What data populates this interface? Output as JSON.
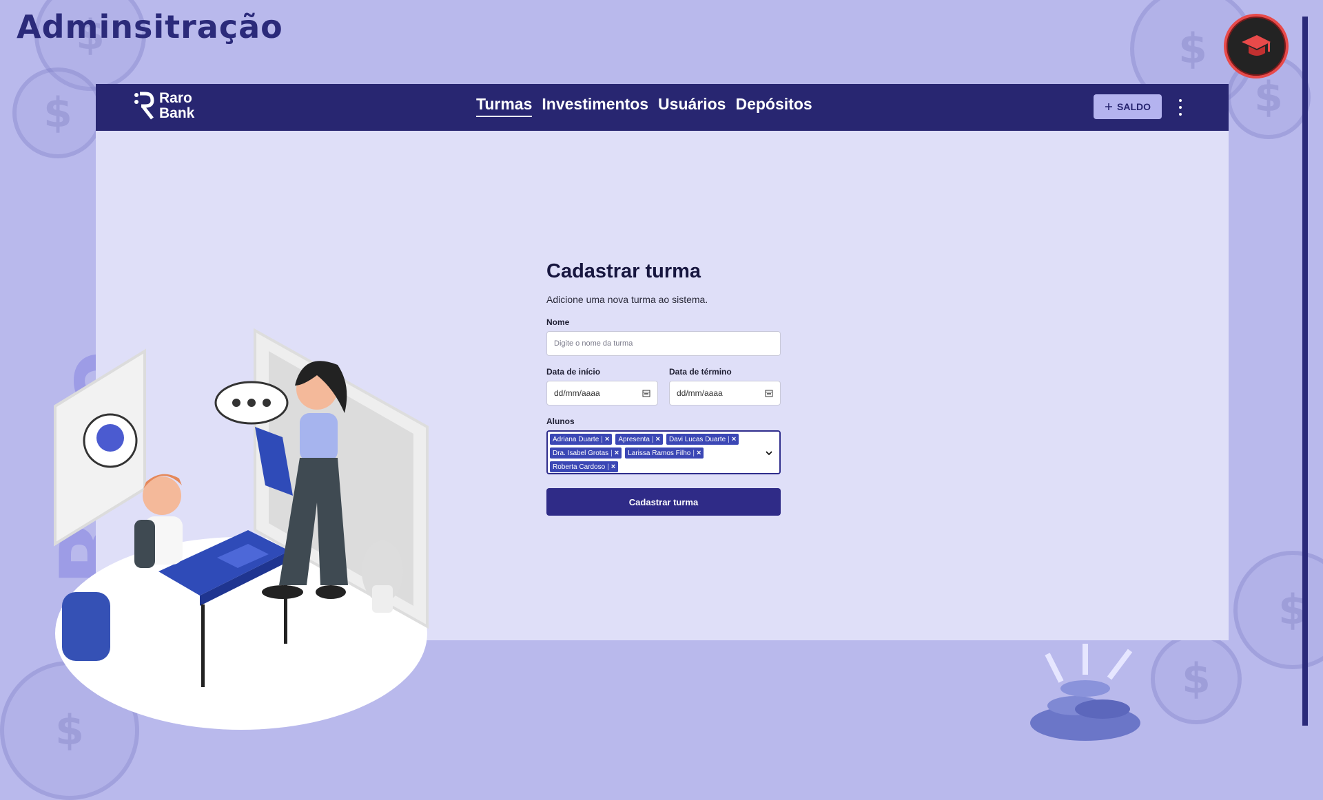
{
  "page_title": "Adminsitração",
  "vertical_brand": "Raro Bank",
  "colors": {
    "background": "#b9b9ec",
    "navbar": "#282671",
    "content": "#dfdff8",
    "primary_button": "#2f2b87",
    "chip": "#3b47b5",
    "saldo_button": "#b4b3ef"
  },
  "navbar": {
    "logo_text": "Raro\nBank",
    "links": [
      {
        "label": "Turmas",
        "active": true
      },
      {
        "label": "Investimentos",
        "active": false
      },
      {
        "label": "Usuários",
        "active": false
      },
      {
        "label": "Depósitos",
        "active": false
      }
    ],
    "saldo_label": "SALDO",
    "saldo_icon": "plus-icon",
    "menu_icon": "kebab-menu-icon"
  },
  "form": {
    "title": "Cadastrar turma",
    "subtitle": "Adicione uma nova turma ao sistema.",
    "nome_label": "Nome",
    "nome_placeholder": "Digite o nome da turma",
    "data_inicio_label": "Data de início",
    "data_inicio_value": "dd/mm/aaaa",
    "data_termino_label": "Data de término",
    "data_termino_value": "dd/mm/aaaa",
    "alunos_label": "Alunos",
    "alunos_selected": [
      "Adriana Duarte",
      "Apresenta",
      "Davi Lucas Duarte",
      "Dra. Isabel Grotas",
      "Larissa Ramos Filho",
      "Roberta Cardoso"
    ],
    "submit_label": "Cadastrar turma"
  }
}
